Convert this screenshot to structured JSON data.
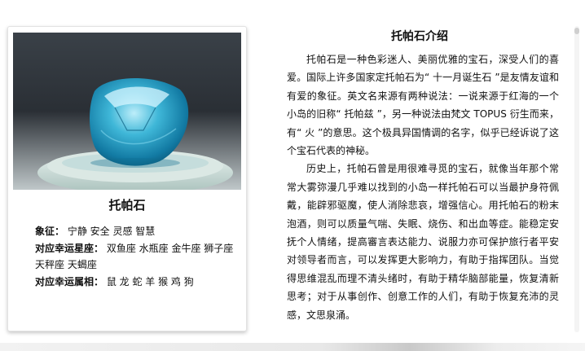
{
  "card": {
    "title": "托帕石",
    "props": [
      {
        "label": "象征：",
        "value": "宁静 安全 灵感 智慧"
      },
      {
        "label": "对应幸运星座：",
        "value": "双鱼座 水瓶座 金牛座 狮子座 天秤座 天蝎座"
      },
      {
        "label": "对应幸运属相：",
        "value": "鼠 龙 蛇 羊 猴 鸡 狗"
      }
    ]
  },
  "article": {
    "title": "托帕石介绍",
    "paragraphs": [
      "托帕石是一种色彩迷人、美丽优雅的宝石，深受人们的喜爱。国际上许多国家定托帕石为“ 十一月诞生石 ”是友情友谊和有爱的象征。英文名来源有两种说法：一说来源于红海的一个小岛的旧称“ 托帕兹 ”，另一种说法由梵文 TOPUS 衍生而来，有“ 火 ”的意思。这个极具异国情调的名字，似乎已经诉说了这个宝石代表的神秘。",
      "历史上，托帕石曾是用很难寻觅的宝石，就像当年那个常常大雾弥漫几乎难以找到的小岛一样托帕石可以当最护身符佩戴，能辟邪驱魔，使人消除悲哀，增强信心。用托帕石的粉末泡酒，则可以质量气喘、失眠、烧伤、和出血等症。能稳定安抚个人情绪，提高審言表达能力、说服力亦可保护旅行者平安对领导者而言，可以发挥更大影响力，有助于指挥团队。当觉得思维混乱而理不清头绪时，有助于精华脑部能量，恢复清新思考；对于从事创作、创意工作的人们，有助于恢复充沛的灵感，文思泉涌。"
    ]
  },
  "colors": {
    "gem": "#2aa3c9",
    "photo_bg": "#2c3238"
  }
}
